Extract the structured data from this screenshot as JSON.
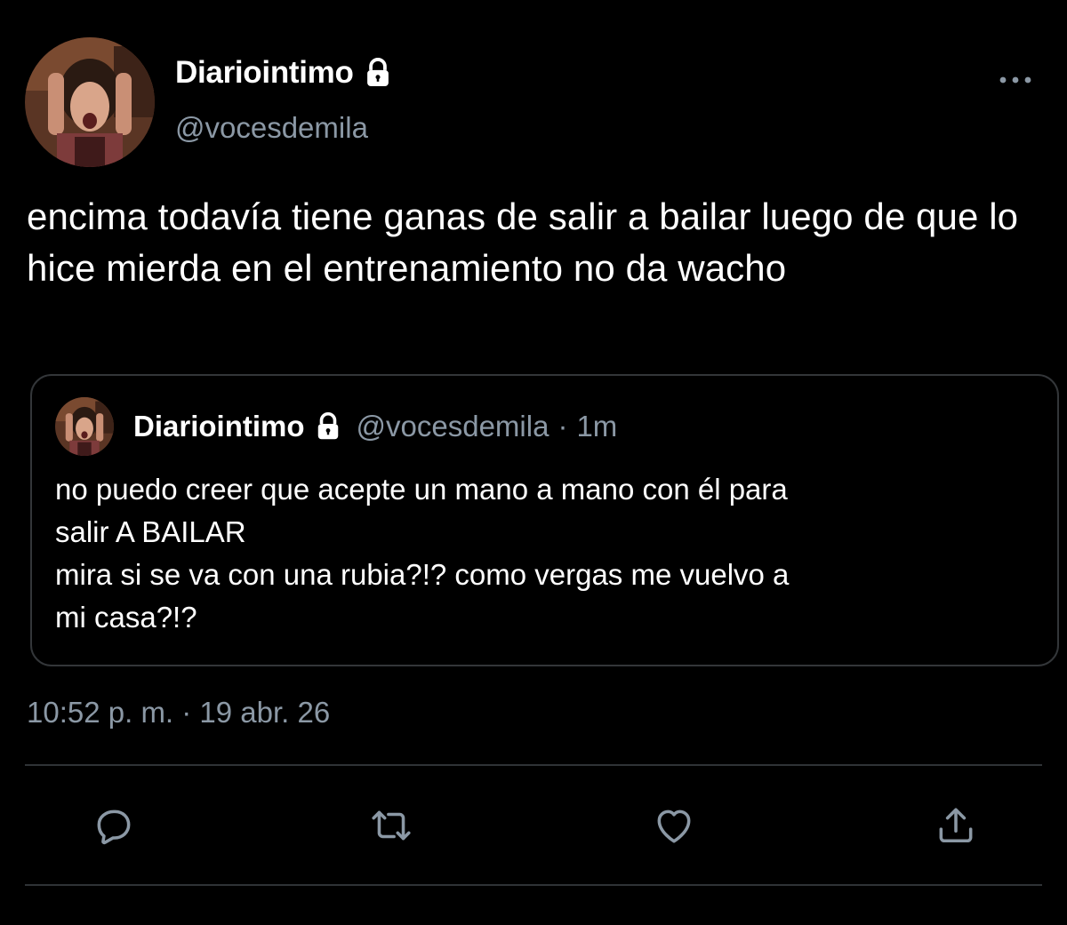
{
  "tweet": {
    "display_name": "Diariointimo",
    "handle": "@vocesdemila",
    "protected_icon": "lock-icon",
    "text": "encima todavía tiene ganas de salir a bailar luego de que lo hice mierda en el entrenamiento no da wacho",
    "timestamp": "10:52 p. m. · 19 abr. 26"
  },
  "quote": {
    "display_name": "Diariointimo",
    "handle": "@vocesdemila",
    "separator": "·",
    "time": "1m",
    "text": "no puedo creer que acepte un mano a mano con él para\nsalir A BAILAR\nmira si se va con una rubia?!? como vergas me vuelvo a\nmi casa?!?"
  },
  "actions": {
    "icons": [
      "reply-icon",
      "retweet-icon",
      "like-icon",
      "share-icon"
    ]
  },
  "colors": {
    "background": "#000000",
    "text_primary": "#ffffff",
    "text_secondary": "#8b98a5",
    "border": "#333639"
  }
}
